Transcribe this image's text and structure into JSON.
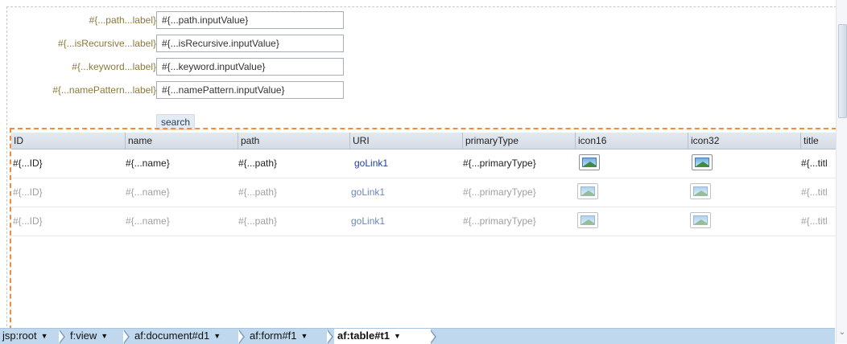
{
  "form": {
    "fields": [
      {
        "label": "#{...path...label}",
        "value": "#{...path.inputValue}"
      },
      {
        "label": "#{...isRecursive...label}",
        "value": "#{...isRecursive.inputValue}"
      },
      {
        "label": "#{...keyword...label}",
        "value": "#{...keyword.inputValue}"
      },
      {
        "label": "#{...namePattern...label}",
        "value": "#{...namePattern.inputValue}"
      }
    ],
    "search_button": "search"
  },
  "table": {
    "columns": [
      "ID",
      "name",
      "path",
      "URI",
      "primaryType",
      "icon16",
      "icon32",
      "title"
    ],
    "rows": [
      {
        "id": "#{...ID}",
        "name": "#{...name}",
        "path": "#{...path}",
        "uri": "goLink1",
        "primaryType": "#{...primaryType}",
        "title": "#{...titl"
      },
      {
        "id": "#{...ID}",
        "name": "#{...name}",
        "path": "#{...path}",
        "uri": "goLink1",
        "primaryType": "#{...primaryType}",
        "title": "#{...titl"
      },
      {
        "id": "#{...ID}",
        "name": "#{...name}",
        "path": "#{...path}",
        "uri": "goLink1",
        "primaryType": "#{...primaryType}",
        "title": "#{...titl"
      }
    ],
    "icon_cells": "image-placeholder-icon"
  },
  "breadcrumb": {
    "items": [
      "jsp:root",
      "f:view",
      "af:document#d1",
      "af:form#f1",
      "af:table#t1"
    ],
    "active": "af:table#t1"
  },
  "colors": {
    "selection_border": "#f08c3c",
    "breadcrumb_bg": "#c0d8ee",
    "label_color": "#8a7a3a",
    "link_color": "#1f3f9f"
  }
}
